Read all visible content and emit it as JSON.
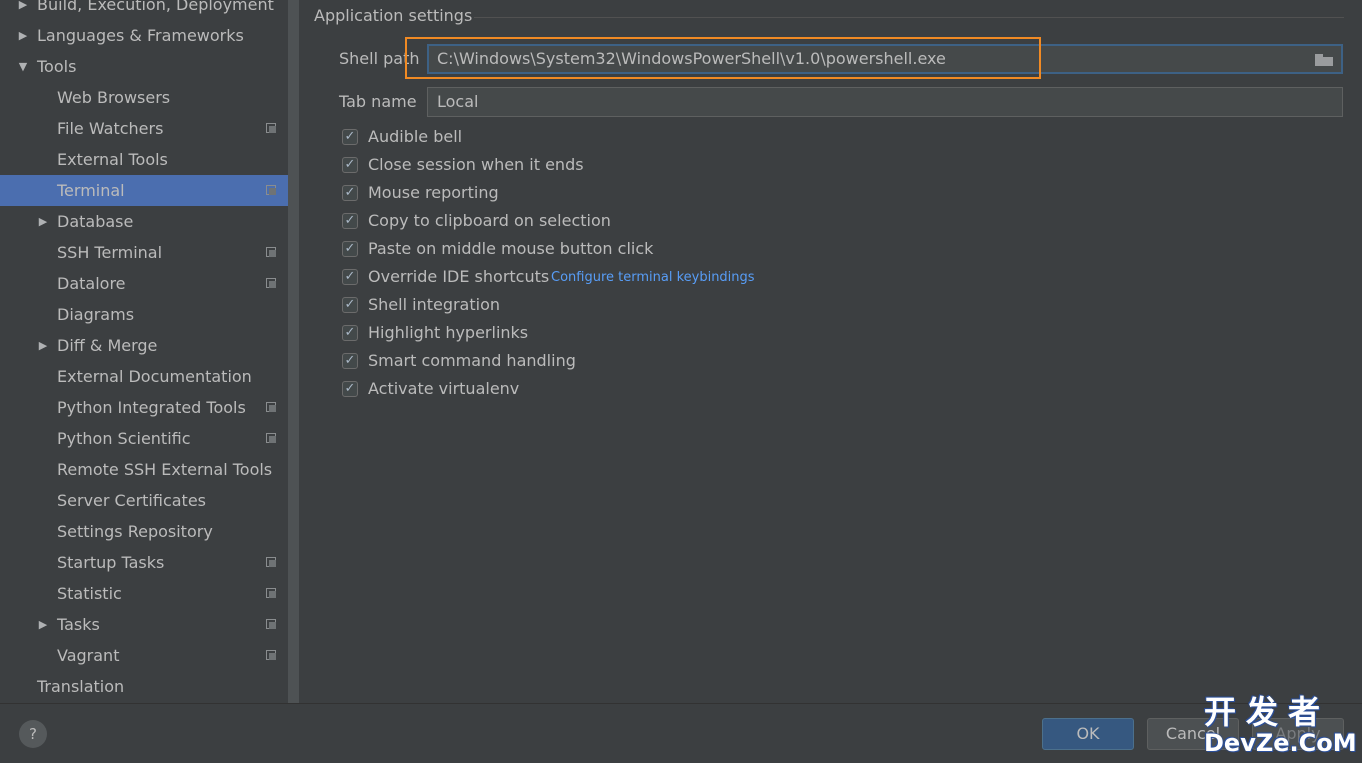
{
  "sidebar": {
    "items": [
      {
        "label": "Build, Execution, Deployment",
        "arrow": "▶",
        "icon": false
      },
      {
        "label": "Languages & Frameworks",
        "arrow": "▶",
        "icon": false
      },
      {
        "label": "Tools",
        "arrow": "▼",
        "icon": false
      },
      {
        "label": "Web Browsers",
        "arrow": "",
        "icon": false
      },
      {
        "label": "File Watchers",
        "arrow": "",
        "icon": true
      },
      {
        "label": "External Tools",
        "arrow": "",
        "icon": false
      },
      {
        "label": "Terminal",
        "arrow": "",
        "icon": true,
        "selected": true
      },
      {
        "label": "Database",
        "arrow": "▶",
        "icon": false
      },
      {
        "label": "SSH Terminal",
        "arrow": "",
        "icon": true
      },
      {
        "label": "Datalore",
        "arrow": "",
        "icon": true
      },
      {
        "label": "Diagrams",
        "arrow": "",
        "icon": false
      },
      {
        "label": "Diff & Merge",
        "arrow": "▶",
        "icon": false
      },
      {
        "label": "External Documentation",
        "arrow": "",
        "icon": false
      },
      {
        "label": "Python Integrated Tools",
        "arrow": "",
        "icon": true
      },
      {
        "label": "Python Scientific",
        "arrow": "",
        "icon": true
      },
      {
        "label": "Remote SSH External Tools",
        "arrow": "",
        "icon": false
      },
      {
        "label": "Server Certificates",
        "arrow": "",
        "icon": false
      },
      {
        "label": "Settings Repository",
        "arrow": "",
        "icon": false
      },
      {
        "label": "Startup Tasks",
        "arrow": "",
        "icon": true
      },
      {
        "label": "Statistic",
        "arrow": "",
        "icon": true
      },
      {
        "label": "Tasks",
        "arrow": "▶",
        "icon": true
      },
      {
        "label": "Vagrant",
        "arrow": "",
        "icon": true
      },
      {
        "label": "Translation",
        "arrow": "",
        "icon": false
      }
    ]
  },
  "settings": {
    "group_title": "Application settings",
    "shell_path_label": "Shell path",
    "shell_path_value": "C:\\Windows\\System32\\WindowsPowerShell\\v1.0\\powershell.exe",
    "tab_name_label": "Tab name",
    "tab_name_value": "Local",
    "checkboxes": [
      {
        "label": "Audible bell",
        "checked": true
      },
      {
        "label": "Close session when it ends",
        "checked": true
      },
      {
        "label": "Mouse reporting",
        "checked": true
      },
      {
        "label": "Copy to clipboard on selection",
        "checked": true
      },
      {
        "label": "Paste on middle mouse button click",
        "checked": true
      },
      {
        "label": "Override IDE shortcuts",
        "checked": true
      },
      {
        "label": "Shell integration",
        "checked": true
      },
      {
        "label": "Highlight hyperlinks",
        "checked": true
      },
      {
        "label": "Smart command handling",
        "checked": true
      },
      {
        "label": "Activate virtualenv",
        "checked": true
      }
    ],
    "keybindings_link": "Configure terminal keybindings"
  },
  "footer": {
    "help_label": "?",
    "ok_label": "OK",
    "cancel_label": "Cancel",
    "apply_label": "Apply"
  },
  "watermark": {
    "chinese": "开发者",
    "english": "DevZe.CoM"
  },
  "colors": {
    "background": "#3c3f41",
    "selection": "#4b6eaf",
    "link": "#589df6",
    "highlight_box": "#f08a24",
    "ok_button": "#365880"
  }
}
